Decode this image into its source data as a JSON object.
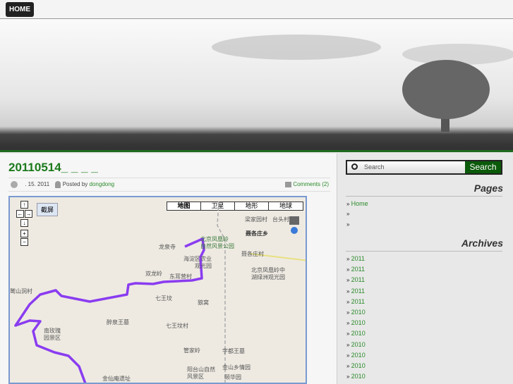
{
  "nav": {
    "home": "HOME"
  },
  "post": {
    "title": "20110514_   _   _   _",
    "date": ".   15. 2011",
    "posted_by": "Posted by",
    "author": "dongdong",
    "comments": "Comments (2)"
  },
  "map": {
    "screenshot_button": "截屏",
    "types": [
      "地图",
      "卫星",
      "地形",
      "地球"
    ],
    "labels": [
      "梁家园村",
      "台头村",
      "聂各庄乡",
      "北京凤凰岭",
      "自然风景公园",
      "龙泉寺",
      "海淀区农业",
      "观光园",
      "聂各庄村",
      "北京凤凰岭中",
      "湖绿洲观光园",
      "双龙岭",
      "东耳营村",
      "七王坟",
      "狼窝",
      "鹫山洞村",
      "醉泉王墓",
      "七王坟村",
      "南玫瑰",
      "园景区",
      "管家岭",
      "字都王墓",
      "阳台山自然",
      "风景区",
      "金山乡情园",
      "颐华园",
      "金仙庵遗址"
    ],
    "route_color": "#8a3cf0"
  },
  "sidebar": {
    "search_placeholder": "Search",
    "search_button": "Search",
    "pages_title": "Pages",
    "pages": [
      "Home",
      "",
      ""
    ],
    "archives_title": "Archives",
    "archives": [
      "2011",
      "2011",
      "2011",
      "2011",
      "2011",
      "2010",
      "2010",
      "2010",
      "2010",
      "2010",
      "2010",
      "2010"
    ]
  }
}
